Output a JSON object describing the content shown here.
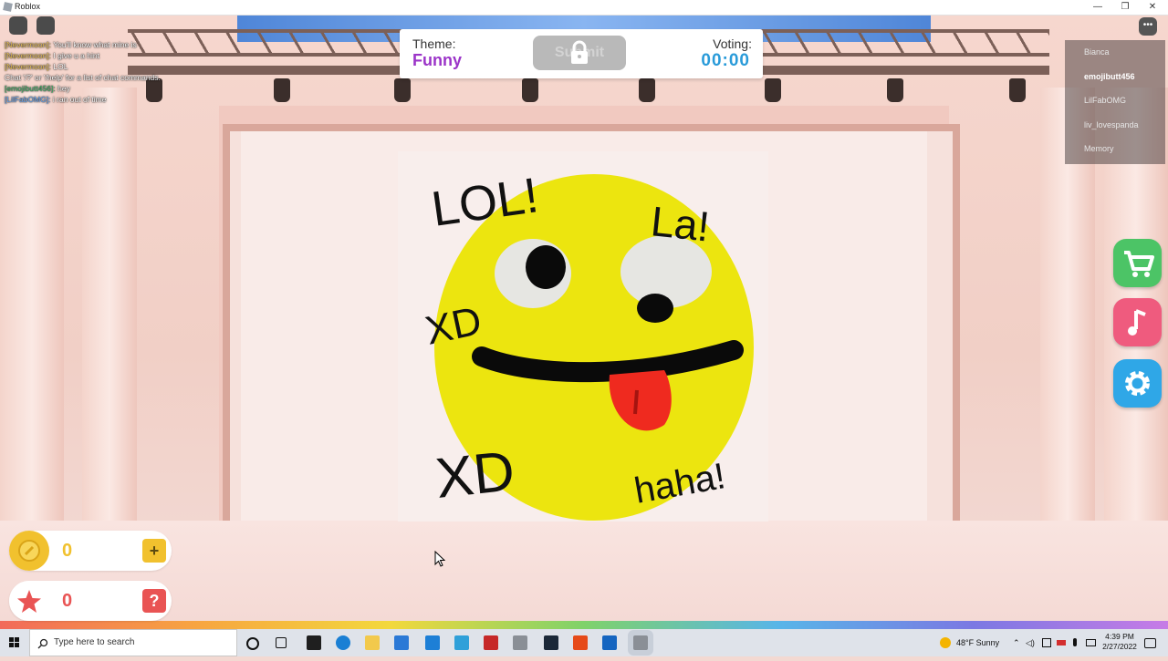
{
  "window": {
    "title": "Roblox",
    "minimize": "—",
    "restore": "❐",
    "close": "✕"
  },
  "theme_panel": {
    "theme_label": "Theme:",
    "theme_value": "Funny",
    "submit_label": "Submit",
    "voting_label": "Voting:",
    "voting_time": "00:00"
  },
  "chat": {
    "messages": [
      {
        "user": "[Nevermoon]:",
        "text": " You'll know what mine is"
      },
      {
        "user": "[Nevermoon]:",
        "text": " I give u a hint"
      },
      {
        "user": "[Nevermoon]:",
        "text": " LOL"
      },
      {
        "user": "",
        "text": "Chat '/?' or '/help' for a list of chat commands."
      },
      {
        "user": "[emojibutt456]:",
        "text": " hey"
      },
      {
        "user": "[LilFabOMG]:",
        "text": " i ran out of time"
      }
    ]
  },
  "players": [
    "Bianca",
    "emojibutt456",
    "LilFabOMG",
    "liv_lovespanda",
    "Memory"
  ],
  "drawing_text": {
    "lol": "LOL!",
    "la": "La!",
    "xd1": "XD",
    "xd2": "XD",
    "haha": "haha!"
  },
  "stats": {
    "coins": "0",
    "stars": "0",
    "add_label": "+",
    "help_label": "?"
  },
  "side_buttons": [
    "shop-cart",
    "music-note",
    "settings-gear"
  ],
  "taskbar": {
    "search_placeholder": "Type here to search",
    "weather": "48°F  Sunny",
    "time": "4:39 PM",
    "date": "2/27/2022"
  },
  "colors": {
    "theme_purple": "#9b34c8",
    "timer_blue": "#2a9bd9",
    "shop_green": "#4cc466",
    "music_pink": "#ef5b7e",
    "settings_blue": "#2fa7e7",
    "coin_yellow": "#f1c12e",
    "star_red": "#e95454"
  }
}
